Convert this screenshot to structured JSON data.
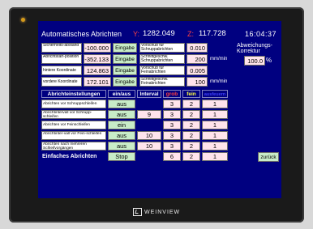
{
  "header": {
    "title": "Automatisches Abrichten",
    "y_label": "Y:",
    "y_value": "1282.049",
    "z_label": "Z:",
    "z_value": "117.728",
    "time": "16:04:37"
  },
  "params_left": [
    {
      "label": "Sicherheits-abstand",
      "value": "-100.000",
      "button": "Eingabe"
    },
    {
      "label": "Abrichtstart-position",
      "value": "-352.133",
      "button": "Eingabe"
    },
    {
      "label": "hintere Koordinate",
      "value": "124.863",
      "button": "Eingabe"
    },
    {
      "label": "vordere Koordinate",
      "value": "172.101",
      "button": "Eingabe"
    }
  ],
  "params_right": [
    {
      "label": "Vorschub für Schruppabrichten",
      "value": "0.010",
      "unit": ""
    },
    {
      "label": "Schnittgeschw. Schruppabrichten",
      "value": "200",
      "unit": "mm/min"
    },
    {
      "label": "Vorschub für Feinabrichten",
      "value": "0.005",
      "unit": ""
    },
    {
      "label": "Schnittgeschw. Feinabrichten",
      "value": "100",
      "unit": "mm/min"
    }
  ],
  "correction": {
    "label": "Abweichungs-Korrektur",
    "value": "100.0",
    "unit": "%"
  },
  "table": {
    "headers": {
      "settings": "Abrichteinstellungen",
      "onoff": "ein/aus",
      "interval": "Interval",
      "coarse": "grob",
      "fine": "fein",
      "spark": "ausfeuern"
    },
    "rows": [
      {
        "label": "Abrichten vor Schruppschleifen",
        "state": "aus",
        "interval": "",
        "coarse": "3",
        "fine": "2",
        "spark": "1"
      },
      {
        "label": "Abrichtintervall vor Schrupp-schleifen",
        "state": "aus",
        "interval": "9",
        "coarse": "3",
        "fine": "2",
        "spark": "1"
      },
      {
        "label": "Abrichten vor Feinschleifen",
        "state": "ein",
        "interval": "",
        "coarse": "3",
        "fine": "2",
        "spark": "1"
      },
      {
        "label": "Abrichtinter-vall vor Fein-schleifen",
        "state": "aus",
        "interval": "10",
        "coarse": "3",
        "fine": "2",
        "spark": "1"
      },
      {
        "label": "Abrichten nach mehreren Schleifvorgängen",
        "state": "aus",
        "interval": "10",
        "coarse": "3",
        "fine": "2",
        "spark": "1"
      }
    ],
    "simple": {
      "label": "Einfaches Abrichten",
      "state": "Stop",
      "coarse": "6",
      "fine": "2",
      "spark": "1"
    }
  },
  "back_button": "zurück",
  "brand": "WEINVIEW",
  "colors": {
    "screen_bg": "#000080",
    "input_bg": "#ffe4ec",
    "button_bg": "#c8ecc8",
    "axis_label": "#ff4040",
    "coarse_header": "#ff4040",
    "fine_header": "#ffff40",
    "spark_header": "#4040ff"
  }
}
